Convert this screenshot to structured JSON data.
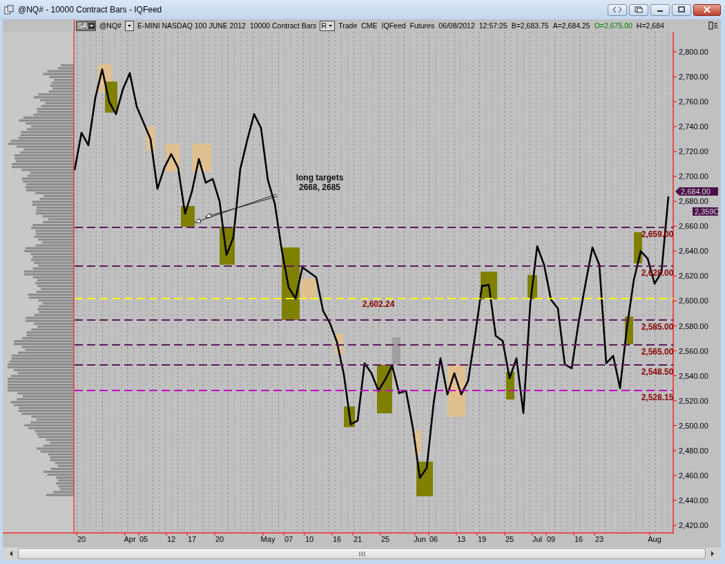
{
  "window": {
    "title": "@NQ# - 10000 Contract Bars - IQFeed"
  },
  "info_bar": [
    {
      "text": "SA",
      "kind": "dropdown"
    },
    {
      "text": "@NQ#",
      "kind": "text"
    },
    {
      "kind": "dropdown"
    },
    {
      "text": "E-MINI NASDAQ 100 JUNE 2012",
      "kind": "text"
    },
    {
      "text": "10000 Contract Bars",
      "kind": "text"
    },
    {
      "text": "R",
      "kind": "dropdown"
    },
    {
      "text": "Trade",
      "kind": "text"
    },
    {
      "text": "CME",
      "kind": "text"
    },
    {
      "text": "IQFeed",
      "kind": "text"
    },
    {
      "text": "Futures",
      "kind": "text"
    },
    {
      "text": "06/08/2012",
      "kind": "text"
    },
    {
      "text": "12:57:25",
      "kind": "text"
    },
    {
      "text": "B=2,683.75",
      "kind": "text"
    },
    {
      "text": "A=2,684.25",
      "kind": "text"
    },
    {
      "text": "O=2,675.00",
      "kind": "text",
      "color": "#008000"
    },
    {
      "text": "H=2,684",
      "kind": "text"
    }
  ],
  "chart": {
    "chart_data": {
      "type": "line",
      "categories": [
        null,
        "20",
        null,
        null,
        null,
        null,
        null,
        null,
        "Apr",
        null,
        "05",
        null,
        null,
        null,
        "12",
        null,
        null,
        "17",
        null,
        null,
        null,
        "20",
        null,
        null,
        null,
        null,
        null,
        null,
        "May",
        null,
        null,
        "07",
        null,
        null,
        "10",
        null,
        null,
        null,
        "16",
        null,
        null,
        "21",
        null,
        null,
        null,
        "25",
        null,
        null,
        null,
        null,
        "Jun",
        null,
        "06",
        null,
        null,
        null,
        "13",
        null,
        null,
        "19",
        null,
        null,
        null,
        "25",
        null,
        null,
        null,
        "Jul",
        null,
        "09",
        null,
        null,
        null,
        "16",
        null,
        null,
        "23",
        null,
        null,
        null,
        null,
        null,
        null,
        null,
        "Aug",
        null,
        null
      ],
      "series": [
        {
          "color": "#000000",
          "values": [
            2705,
            2735,
            2725,
            2763,
            2786,
            2760,
            2750,
            2770,
            2783,
            2756,
            2743,
            2730,
            2690,
            2707,
            2718,
            2707,
            2670,
            2688,
            2714,
            2695,
            2698,
            2680,
            2637,
            2651,
            2706,
            2729,
            2750,
            2739,
            2697,
            2678,
            2641,
            2611,
            2602,
            2627,
            2623,
            2619,
            2592,
            2582,
            2567,
            2541,
            2501,
            2504,
            2550,
            2542,
            2528,
            2537,
            2548,
            2526,
            2528,
            2498,
            2458,
            2466,
            2518,
            2554,
            2525,
            2542,
            2525,
            2536,
            2572,
            2612,
            2613,
            2572,
            2568,
            2538,
            2554,
            2510,
            2598,
            2644,
            2629,
            2601,
            2594,
            2549,
            2546,
            2583,
            2614,
            2643,
            2629,
            2550,
            2556,
            2530,
            2579,
            2617,
            2640,
            2634,
            2614,
            2623,
            2684
          ]
        }
      ],
      "ylim": [
        2414.4,
        2816.1
      ],
      "yticks": [
        {
          "value": 2800,
          "label": "2,800.00"
        },
        {
          "value": 2780,
          "label": "2,780.00"
        },
        {
          "value": 2760,
          "label": "2,760.00"
        },
        {
          "value": 2740,
          "label": "2,740.00"
        },
        {
          "value": 2720,
          "label": "2,720.00"
        },
        {
          "value": 2700,
          "label": "2,700.00"
        },
        {
          "value": 2680,
          "label": "2,680.00"
        },
        {
          "value": 2660,
          "label": "2,660.00"
        },
        {
          "value": 2640,
          "label": "2,640.00"
        },
        {
          "value": 2620,
          "label": "2,620.00"
        },
        {
          "value": 2600,
          "label": "2,600.00"
        },
        {
          "value": 2580,
          "label": "2,580.00"
        },
        {
          "value": 2560,
          "label": "2,560.00"
        },
        {
          "value": 2540,
          "label": "2,540.00"
        },
        {
          "value": 2520,
          "label": "2,520.00"
        },
        {
          "value": 2500,
          "label": "2,500.00"
        },
        {
          "value": 2480,
          "label": "2,480.00"
        },
        {
          "value": 2460,
          "label": "2,460.00"
        },
        {
          "value": 2440,
          "label": "2,440.00"
        },
        {
          "value": 2420,
          "label": "2,420.00"
        }
      ]
    }
  },
  "levels": [
    {
      "label": "2,659.00",
      "color": "#5a1a5a"
    },
    {
      "label": "2,628.00",
      "color": "#5a1a5a"
    },
    {
      "label": "2,602.24",
      "color": "#ffff00"
    },
    {
      "label": "2,585.00",
      "color": "#5a1a5a"
    },
    {
      "label": "2,565.00",
      "color": "#5a1a5a"
    },
    {
      "label": "2,548.50",
      "color": "#5a1a5a"
    },
    {
      "label": "2,528.15",
      "color": "#c000c0"
    }
  ],
  "price_tags": [
    {
      "text": "2,684.00"
    },
    {
      "text": "2,359C"
    }
  ],
  "annotation": {
    "lines": [
      "long targets",
      "2668, 2685"
    ]
  }
}
